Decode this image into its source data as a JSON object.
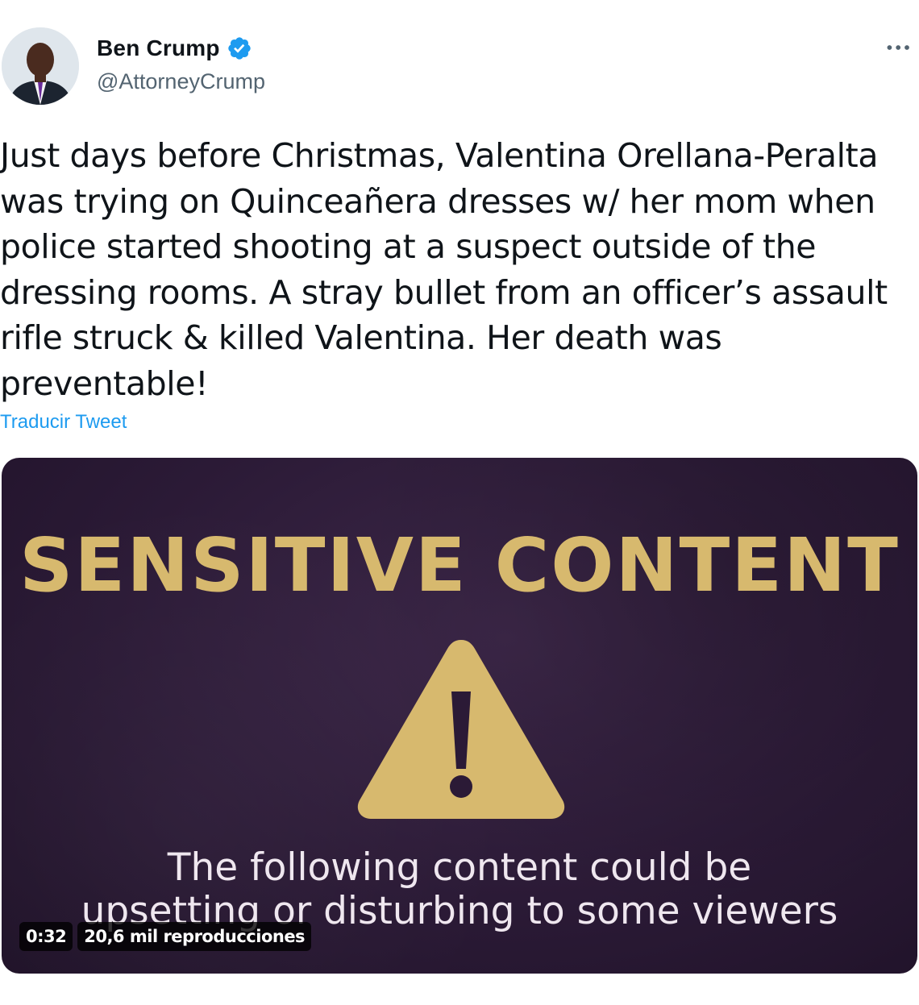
{
  "author": {
    "name": "Ben Crump",
    "handle": "@AttorneyCrump",
    "verified_icon": "verified-badge-icon",
    "avatar_icon": "profile-avatar"
  },
  "more_menu_icon": "more-options-icon",
  "tweet": {
    "text": "Just days before Christmas, Valentina Orellana-Peralta was trying on Quinceañera dresses w/ her mom when police started shooting at a suspect outside of the dressing rooms. A stray bullet from an officer’s assault rifle struck & killed Valentina. Her death was preventable!",
    "translate_link": "Traducir Tweet"
  },
  "media": {
    "title": "SENSITIVE CONTENT",
    "warning_icon": "warning-triangle-icon",
    "subtitle_line1": "The following content could be",
    "subtitle_line2": "upsetting or disturbing to some viewers",
    "duration": "0:32",
    "views": "20,6 mil reproducciones"
  },
  "colors": {
    "link_blue": "#1d9bf0",
    "verified_blue": "#1d9bf0",
    "media_background": "#2b1a36",
    "warning_gold": "#d7b96e"
  }
}
